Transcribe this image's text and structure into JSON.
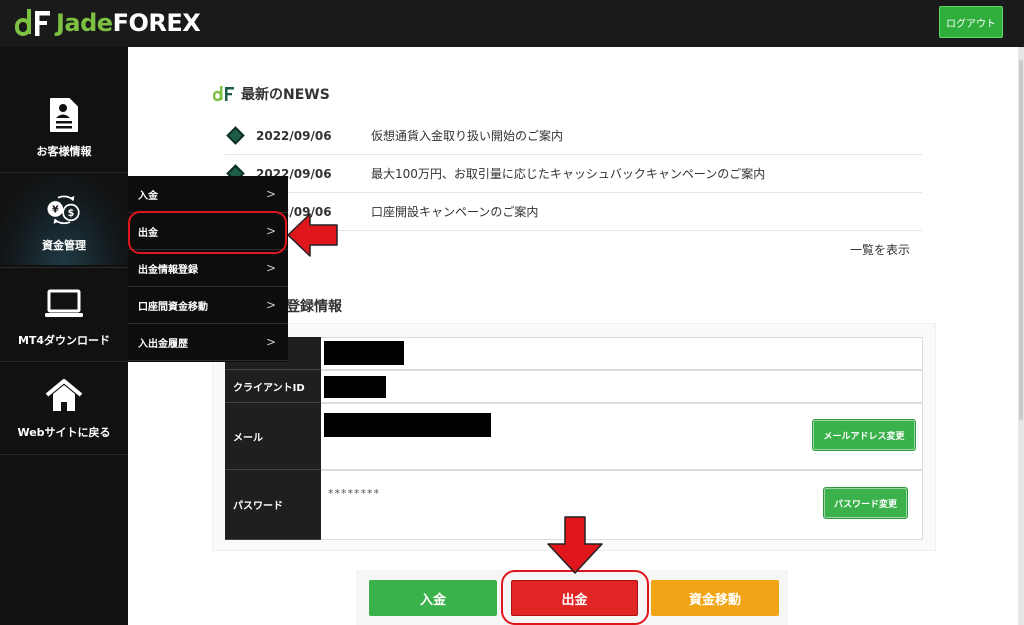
{
  "header": {
    "brand_jade": "Jade",
    "brand_forex": "FOREX",
    "logout_label": "ログアウト"
  },
  "sidebar": {
    "items": [
      {
        "label": "お客様情報",
        "icon": "document-user-icon"
      },
      {
        "label": "資金管理",
        "icon": "currency-exchange-icon"
      },
      {
        "label": "MT4ダウンロード",
        "icon": "laptop-icon"
      },
      {
        "label": "Webサイトに戻る",
        "icon": "home-icon"
      }
    ]
  },
  "submenu": {
    "items": [
      {
        "label": "入金",
        "chev": ">"
      },
      {
        "label": "出金",
        "chev": ">"
      },
      {
        "label": "出金情報登録",
        "chev": ">"
      },
      {
        "label": "口座間資金移動",
        "chev": ">"
      },
      {
        "label": "入出金履歴",
        "chev": ">"
      }
    ]
  },
  "news": {
    "title": "最新のNEWS",
    "items": [
      {
        "date": "2022/09/06",
        "text": "仮想通貨入金取り扱い開始のご案内"
      },
      {
        "date": "2022/09/06",
        "text": "最大100万円、お取引量に応じたキャッシュバックキャンペーンのご案内"
      },
      {
        "date": "2022/09/06",
        "text": "口座開設キャンペーンのご案内"
      }
    ],
    "more_label": "一覧を表示"
  },
  "registration": {
    "title": "登録情報",
    "rows": [
      {
        "label": ""
      },
      {
        "label": "クライアントID"
      },
      {
        "label": "メール"
      },
      {
        "label": "パスワード"
      }
    ],
    "password_masked": "********",
    "change_email_label": "メールアドレス変更",
    "change_password_label": "パスワード変更"
  },
  "actions": {
    "deposit_label": "入金",
    "withdraw_label": "出金",
    "transfer_label": "資金移動"
  },
  "colors": {
    "accent_green": "#3ab14a",
    "withdraw_red": "#e12424",
    "transfer_orange": "#f1a416",
    "annotation_red": "#e0161d"
  }
}
